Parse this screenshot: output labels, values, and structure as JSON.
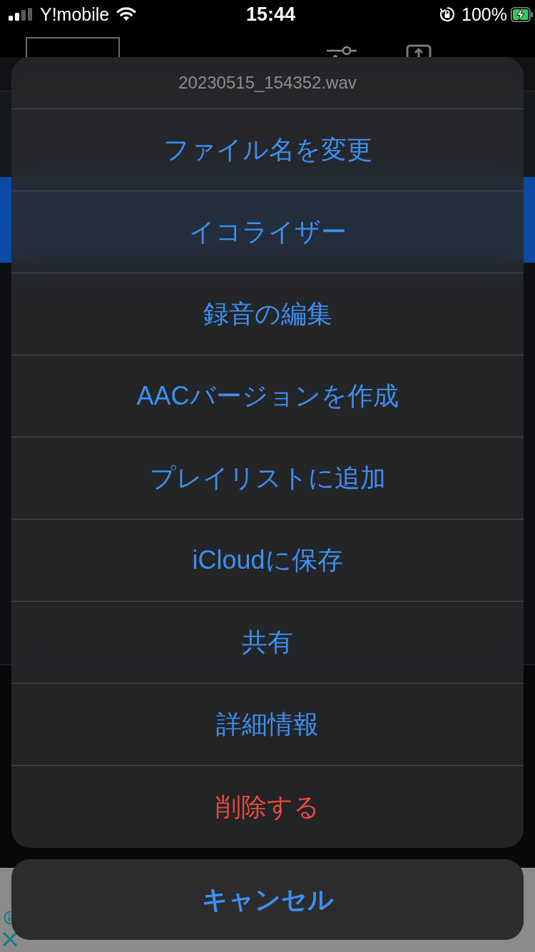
{
  "status_bar": {
    "carrier": "Y!mobile",
    "time": "15:44",
    "battery_percent": "100%"
  },
  "action_sheet": {
    "title": "20230515_154352.wav",
    "actions": [
      {
        "label": "ファイル名を変更",
        "kind": "default"
      },
      {
        "label": "イコライザー",
        "kind": "default"
      },
      {
        "label": "録音の編集",
        "kind": "default"
      },
      {
        "label": "AACバージョンを作成",
        "kind": "default"
      },
      {
        "label": "プレイリストに追加",
        "kind": "default"
      },
      {
        "label": "iCloudに保存",
        "kind": "default"
      },
      {
        "label": "共有",
        "kind": "default"
      },
      {
        "label": "詳細情報",
        "kind": "default"
      },
      {
        "label": "削除する",
        "kind": "destructive"
      }
    ],
    "cancel": {
      "label": "キャンセル"
    }
  }
}
